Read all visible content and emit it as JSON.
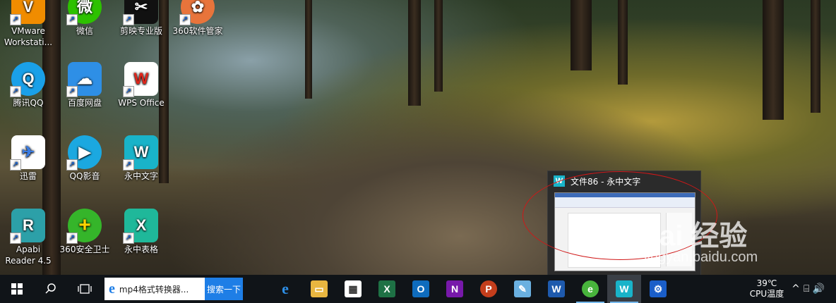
{
  "desktop": {
    "icons": [
      {
        "label": "VMware Workstati...",
        "glyph": "V"
      },
      {
        "label": "微信",
        "glyph": "微"
      },
      {
        "label": "剪映专业版",
        "glyph": "✂"
      },
      {
        "label": "360软件管家",
        "glyph": "✿"
      },
      {
        "label": "腾讯QQ",
        "glyph": "Q"
      },
      {
        "label": "百度网盘",
        "glyph": "☁"
      },
      {
        "label": "WPS Office",
        "glyph": "W"
      },
      {
        "label": "迅雷",
        "glyph": "✈"
      },
      {
        "label": "QQ影音",
        "glyph": "▶"
      },
      {
        "label": "永中文字",
        "glyph": "W"
      },
      {
        "label": "Apabi Reader 4.5",
        "glyph": "R"
      },
      {
        "label": "360安全卫士",
        "glyph": "+"
      },
      {
        "label": "永中表格",
        "glyph": "X"
      }
    ],
    "colors": {
      "vmware": "#f08c00",
      "wechat": "#2dc100",
      "jianying": "#111111",
      "soft360": "#e8743b",
      "qq": "#1aa0e8",
      "baidu": "#2e8fe6",
      "wps": "#ffffff",
      "xunlei": "#ffffff",
      "qqplayer": "#1ba8e0",
      "yzwenzi": "#19b3c9",
      "apabi": "#2ca0a8",
      "safe360": "#35b52a",
      "yzbiaoge": "#1fb89a"
    }
  },
  "taskbar": {
    "search": {
      "text": "mp4格式转换器...",
      "button": "搜索一下"
    },
    "apps": [
      {
        "name": "edge",
        "glyph": "e",
        "color": "#0a6fd1"
      },
      {
        "name": "file-explorer",
        "glyph": "▭",
        "color": "#e8b640"
      },
      {
        "name": "store",
        "glyph": "▦",
        "color": "#3a3a3a"
      },
      {
        "name": "excel",
        "glyph": "X",
        "color": "#1e7145"
      },
      {
        "name": "outlook",
        "glyph": "O",
        "color": "#0f6cbd"
      },
      {
        "name": "onenote",
        "glyph": "N",
        "color": "#7719aa"
      },
      {
        "name": "powerpoint",
        "glyph": "P",
        "color": "#c43e1c"
      },
      {
        "name": "paint",
        "glyph": "✎",
        "color": "#6ab0e0"
      },
      {
        "name": "word",
        "glyph": "W",
        "color": "#1e5aad"
      },
      {
        "name": "browser-360",
        "glyph": "e",
        "color": "#48b43c"
      },
      {
        "name": "yongzhong-wenzi",
        "glyph": "W",
        "color": "#19b3c9"
      },
      {
        "name": "settings",
        "glyph": "⚙",
        "color": "#1a5ec8"
      }
    ],
    "tray": {
      "temp": "39℃",
      "temp_label": "CPU温度",
      "chevron": "^",
      "glyphs": "⌸ 🔊"
    }
  },
  "thumbnail": {
    "title": "文件86 - 永中文字",
    "app_glyph": "W"
  },
  "watermark": {
    "logo": "Bai 经验",
    "url": "jingyan.baidu.com"
  }
}
